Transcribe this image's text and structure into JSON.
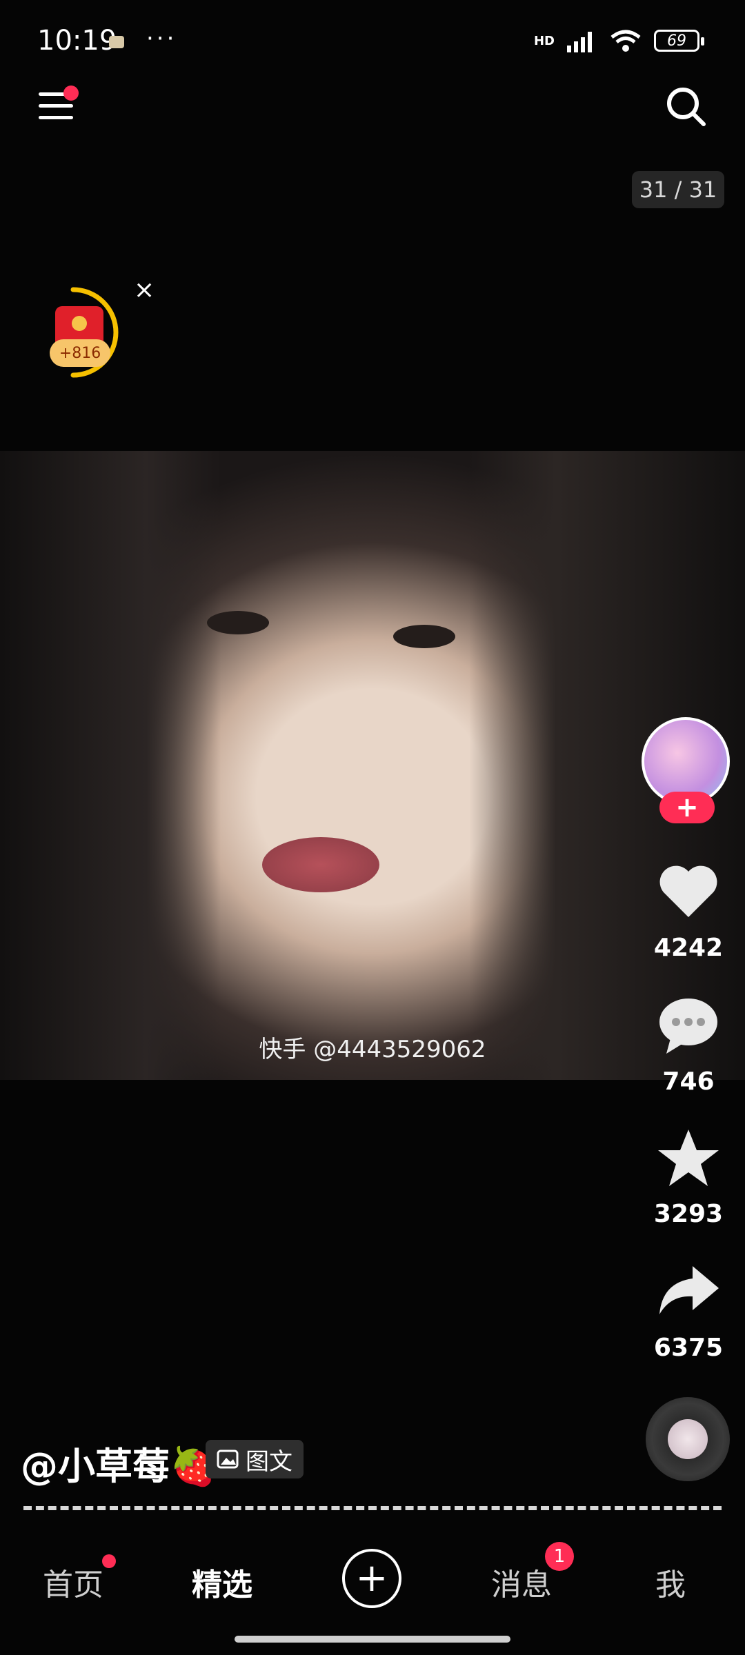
{
  "status_bar": {
    "time": "10:19",
    "more": "···",
    "network": "HD",
    "battery": "69"
  },
  "top": {
    "page_counter": "31 / 31"
  },
  "red_packet": {
    "amount": "+816",
    "close": "×"
  },
  "photo": {
    "watermark": "快手 @4443529062"
  },
  "actions": {
    "follow": "+",
    "likes": "4242",
    "comments": "746",
    "favorites": "3293",
    "shares": "6375"
  },
  "caption": {
    "author": "@小草莓🍓",
    "type_tag": "图文"
  },
  "bottom_nav": {
    "home": "首页",
    "featured": "精选",
    "add": "+",
    "messages": "消息",
    "messages_badge": "1",
    "me": "我"
  },
  "colors": {
    "accent": "#ff2d55",
    "background": "#050505"
  },
  "icons": [
    "menu-icon",
    "search-icon",
    "heart-icon",
    "comment-icon",
    "star-icon",
    "share-icon",
    "image-icon",
    "plus-icon"
  ]
}
